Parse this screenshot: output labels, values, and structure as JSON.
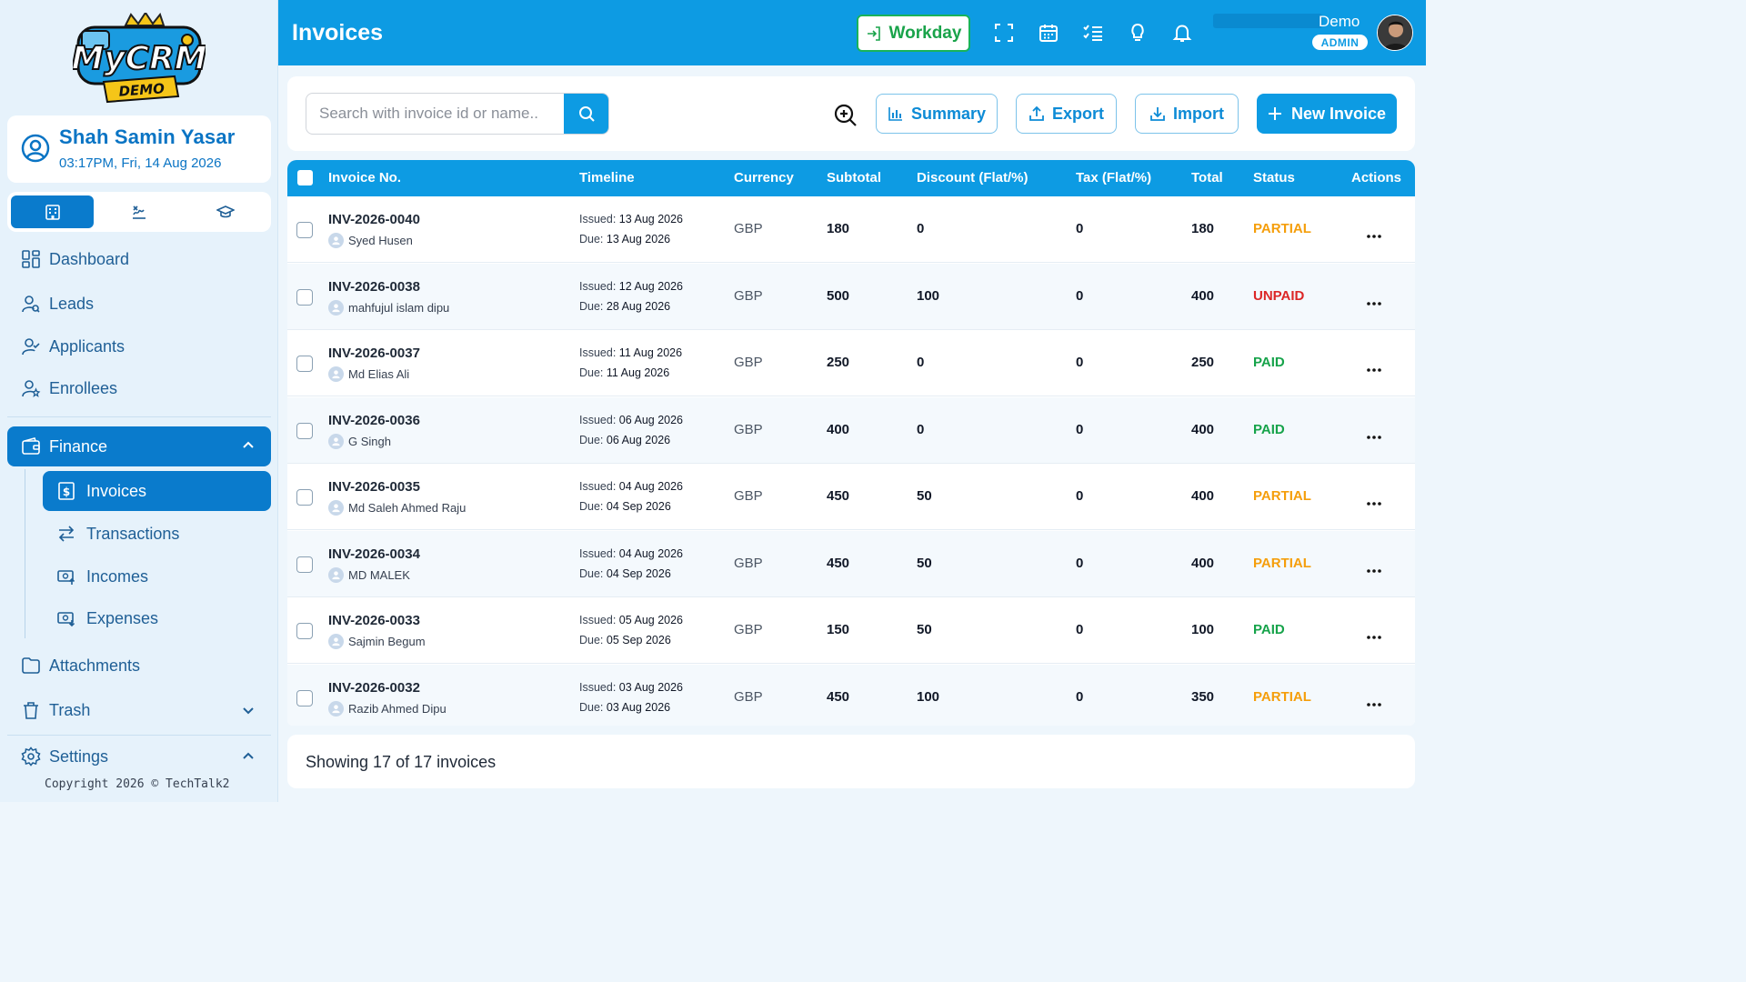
{
  "sidebar": {
    "logo_text": "MyCRM DEMO",
    "user": {
      "name": "Shah Samin Yasar",
      "datetime": "03:17PM, Fri, 14 Aug 2026"
    },
    "segments": [
      {
        "icon": "building-icon",
        "active": true
      },
      {
        "icon": "sign-icon",
        "active": false
      },
      {
        "icon": "graduation-cap-icon",
        "active": false
      }
    ],
    "nav": {
      "dashboard": "Dashboard",
      "leads": "Leads",
      "applicants": "Applicants",
      "enrollees": "Enrollees",
      "finance": "Finance",
      "invoices": "Invoices",
      "transactions": "Transactions",
      "incomes": "Incomes",
      "expenses": "Expenses",
      "attachments": "Attachments",
      "trash": "Trash",
      "settings": "Settings"
    },
    "copyright": "Copyright 2026 © TechTalk2"
  },
  "header": {
    "title": "Invoices",
    "workday": "Workday",
    "user_name": "Demo",
    "role": "ADMIN"
  },
  "toolbar": {
    "search_placeholder": "Search with invoice id or name..",
    "summary": "Summary",
    "export": "Export",
    "import": "Import",
    "new_invoice": "New Invoice"
  },
  "table": {
    "columns": {
      "invoice_no": "Invoice No.",
      "timeline": "Timeline",
      "currency": "Currency",
      "subtotal": "Subtotal",
      "discount": "Discount (Flat/%)",
      "tax": "Tax (Flat/%)",
      "total": "Total",
      "status": "Status",
      "actions": "Actions"
    },
    "rows": [
      {
        "id": "INV-2026-0040",
        "customer": "Syed Husen",
        "issued_label": "Issued:",
        "issued": "13 Aug 2026",
        "due_label": "Due:",
        "due": "13 Aug 2026",
        "currency": "GBP",
        "subtotal": "180",
        "discount": "0",
        "tax": "0",
        "total": "180",
        "status": "PARTIAL"
      },
      {
        "id": "INV-2026-0038",
        "customer": "mahfujul islam dipu",
        "issued_label": "Issued:",
        "issued": "12 Aug 2026",
        "due_label": "Due:",
        "due": "28 Aug 2026",
        "currency": "GBP",
        "subtotal": "500",
        "discount": "100",
        "tax": "0",
        "total": "400",
        "status": "UNPAID"
      },
      {
        "id": "INV-2026-0037",
        "customer": "Md Elias Ali",
        "issued_label": "Issued:",
        "issued": "11 Aug 2026",
        "due_label": "Due:",
        "due": "11 Aug 2026",
        "currency": "GBP",
        "subtotal": "250",
        "discount": "0",
        "tax": "0",
        "total": "250",
        "status": "PAID"
      },
      {
        "id": "INV-2026-0036",
        "customer": "G Singh",
        "issued_label": "Issued:",
        "issued": "06 Aug 2026",
        "due_label": "Due:",
        "due": "06 Aug 2026",
        "currency": "GBP",
        "subtotal": "400",
        "discount": "0",
        "tax": "0",
        "total": "400",
        "status": "PAID"
      },
      {
        "id": "INV-2026-0035",
        "customer": "Md Saleh Ahmed Raju",
        "issued_label": "Issued:",
        "issued": "04 Aug 2026",
        "due_label": "Due:",
        "due": "04 Sep 2026",
        "currency": "GBP",
        "subtotal": "450",
        "discount": "50",
        "tax": "0",
        "total": "400",
        "status": "PARTIAL"
      },
      {
        "id": "INV-2026-0034",
        "customer": "MD MALEK",
        "issued_label": "Issued:",
        "issued": "04 Aug 2026",
        "due_label": "Due:",
        "due": "04 Sep 2026",
        "currency": "GBP",
        "subtotal": "450",
        "discount": "50",
        "tax": "0",
        "total": "400",
        "status": "PARTIAL"
      },
      {
        "id": "INV-2026-0033",
        "customer": "Sajmin Begum",
        "issued_label": "Issued:",
        "issued": "05 Aug 2026",
        "due_label": "Due:",
        "due": "05 Sep 2026",
        "currency": "GBP",
        "subtotal": "150",
        "discount": "50",
        "tax": "0",
        "total": "100",
        "status": "PAID"
      },
      {
        "id": "INV-2026-0032",
        "customer": "Razib Ahmed Dipu",
        "issued_label": "Issued:",
        "issued": "03 Aug 2026",
        "due_label": "Due:",
        "due": "03 Aug 2026",
        "currency": "GBP",
        "subtotal": "450",
        "discount": "100",
        "tax": "0",
        "total": "350",
        "status": "PARTIAL"
      }
    ]
  },
  "footer": {
    "showing": "Showing 17 of 17 invoices"
  },
  "colors": {
    "primary": "#0d9be3",
    "sidebar_active": "#0a7bcc",
    "paid": "#16a34a",
    "partial": "#f59e0b",
    "unpaid": "#dc2626"
  }
}
